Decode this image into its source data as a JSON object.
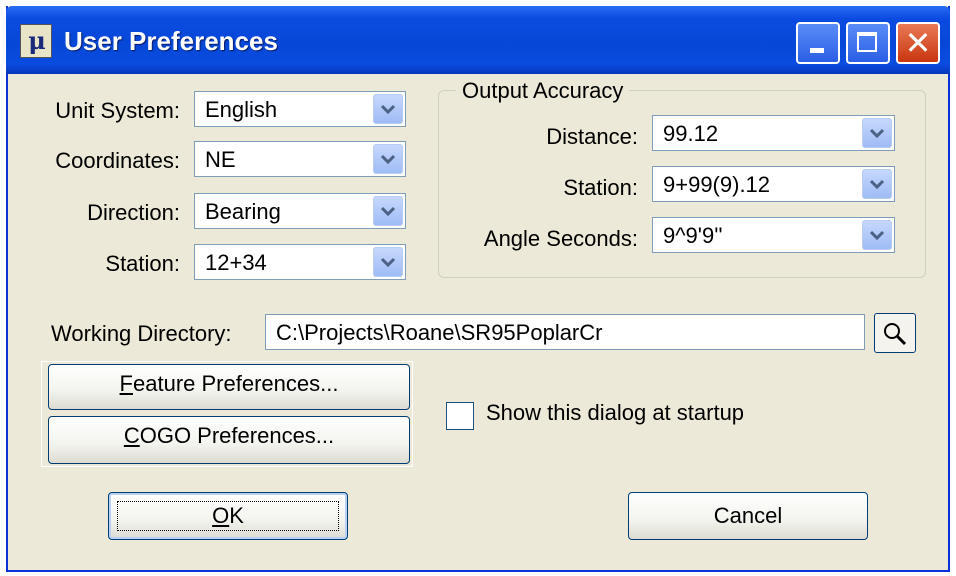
{
  "window": {
    "title": "User Preferences",
    "app_icon_text": "μ",
    "minimize_label": "Minimize",
    "maximize_label": "Maximize",
    "close_label": "✕"
  },
  "settings": {
    "unit_system": {
      "label": "Unit System:",
      "value": "English"
    },
    "coordinates": {
      "label": "Coordinates:",
      "value": "NE"
    },
    "direction": {
      "label": "Direction:",
      "value": "Bearing"
    },
    "station": {
      "label": "Station:",
      "value": "12+34"
    }
  },
  "output_accuracy": {
    "title": "Output Accuracy",
    "distance": {
      "label": "Distance:",
      "value": "99.12"
    },
    "station": {
      "label": "Station:",
      "value": "9+99(9).12"
    },
    "angle_seconds": {
      "label": "Angle Seconds:",
      "value": "9^9'9''"
    }
  },
  "working_directory": {
    "label": "Working Directory:",
    "value": "C:\\Projects\\Roane\\SR95PoplarCr"
  },
  "buttons": {
    "feature_prefs_mnemonic": "F",
    "feature_prefs_rest": "eature Preferences...",
    "cogo_prefs_mnemonic": "C",
    "cogo_prefs_rest": "OGO Preferences...",
    "ok_mnemonic": "O",
    "ok_rest": "K",
    "cancel": "Cancel"
  },
  "startup": {
    "checked": false,
    "label": "Show this dialog at startup"
  },
  "colors": {
    "title_bar": "#0747d7",
    "dialog_bg": "#ece9d8",
    "close_button": "#c8350f"
  }
}
